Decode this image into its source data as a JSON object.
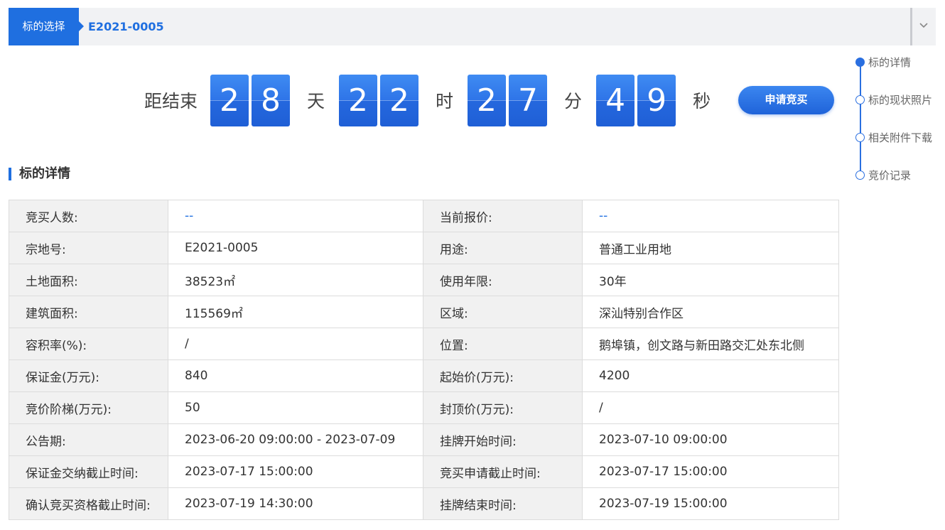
{
  "selector": {
    "label": "标的选择",
    "value": "E2021-0005"
  },
  "countdown": {
    "prefix": "距结束",
    "days": [
      "2",
      "8"
    ],
    "day_unit": "天",
    "hours": [
      "2",
      "2"
    ],
    "hour_unit": "时",
    "minutes": [
      "2",
      "7"
    ],
    "minute_unit": "分",
    "seconds": [
      "4",
      "9"
    ],
    "second_unit": "秒"
  },
  "apply_button": "申请竞买",
  "side_nav": [
    {
      "label": "标的详情",
      "active": true
    },
    {
      "label": "标的现状照片",
      "active": false
    },
    {
      "label": "相关附件下载",
      "active": false
    },
    {
      "label": "竞价记录",
      "active": false
    }
  ],
  "section_title": "标的详情",
  "details": [
    [
      "竞买人数:",
      "--",
      "当前报价:",
      "--"
    ],
    [
      "宗地号:",
      "E2021-0005",
      "用途:",
      "普通工业用地"
    ],
    [
      "土地面积:",
      "38523㎡",
      "使用年限:",
      "30年"
    ],
    [
      "建筑面积:",
      "115569㎡",
      "区域:",
      "深汕特别合作区"
    ],
    [
      "容积率(%):",
      "/",
      "位置:",
      "鹅埠镇，创文路与新田路交汇处东北侧"
    ],
    [
      "保证金(万元):",
      "840",
      "起始价(万元):",
      "4200"
    ],
    [
      "竞价阶梯(万元):",
      "50",
      "封顶价(万元):",
      "/"
    ],
    [
      "公告期:",
      "2023-06-20 09:00:00 - 2023-07-09",
      "挂牌开始时间:",
      "2023-07-10 09:00:00"
    ],
    [
      "保证金交纳截止时间:",
      "2023-07-17 15:00:00",
      "竞买申请截止时间:",
      "2023-07-17 15:00:00"
    ],
    [
      "确认竞买资格截止时间:",
      "2023-07-19 14:30:00",
      "挂牌结束时间:",
      "2023-07-19 15:00:00"
    ]
  ]
}
